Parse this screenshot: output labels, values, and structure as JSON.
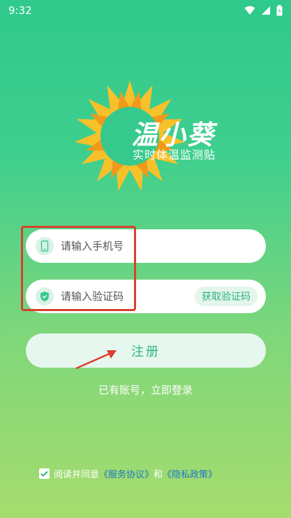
{
  "status": {
    "time": "9:32"
  },
  "app": {
    "name": "温小葵",
    "subtitle": "实时体温监测贴"
  },
  "form": {
    "phone_placeholder": "请输入手机号",
    "code_placeholder": "请输入验证码",
    "get_code_label": "获取验证码",
    "register_label": "注册",
    "login_link": "已有账号，立即登录"
  },
  "agreement": {
    "prefix": "阅读并同意",
    "service": "《服务协议》",
    "and": "和",
    "privacy": "《隐私政策》",
    "checked": true
  },
  "colors": {
    "accent": "#2bb57e",
    "link": "#1e77c8",
    "annotation": "#d8412f"
  }
}
